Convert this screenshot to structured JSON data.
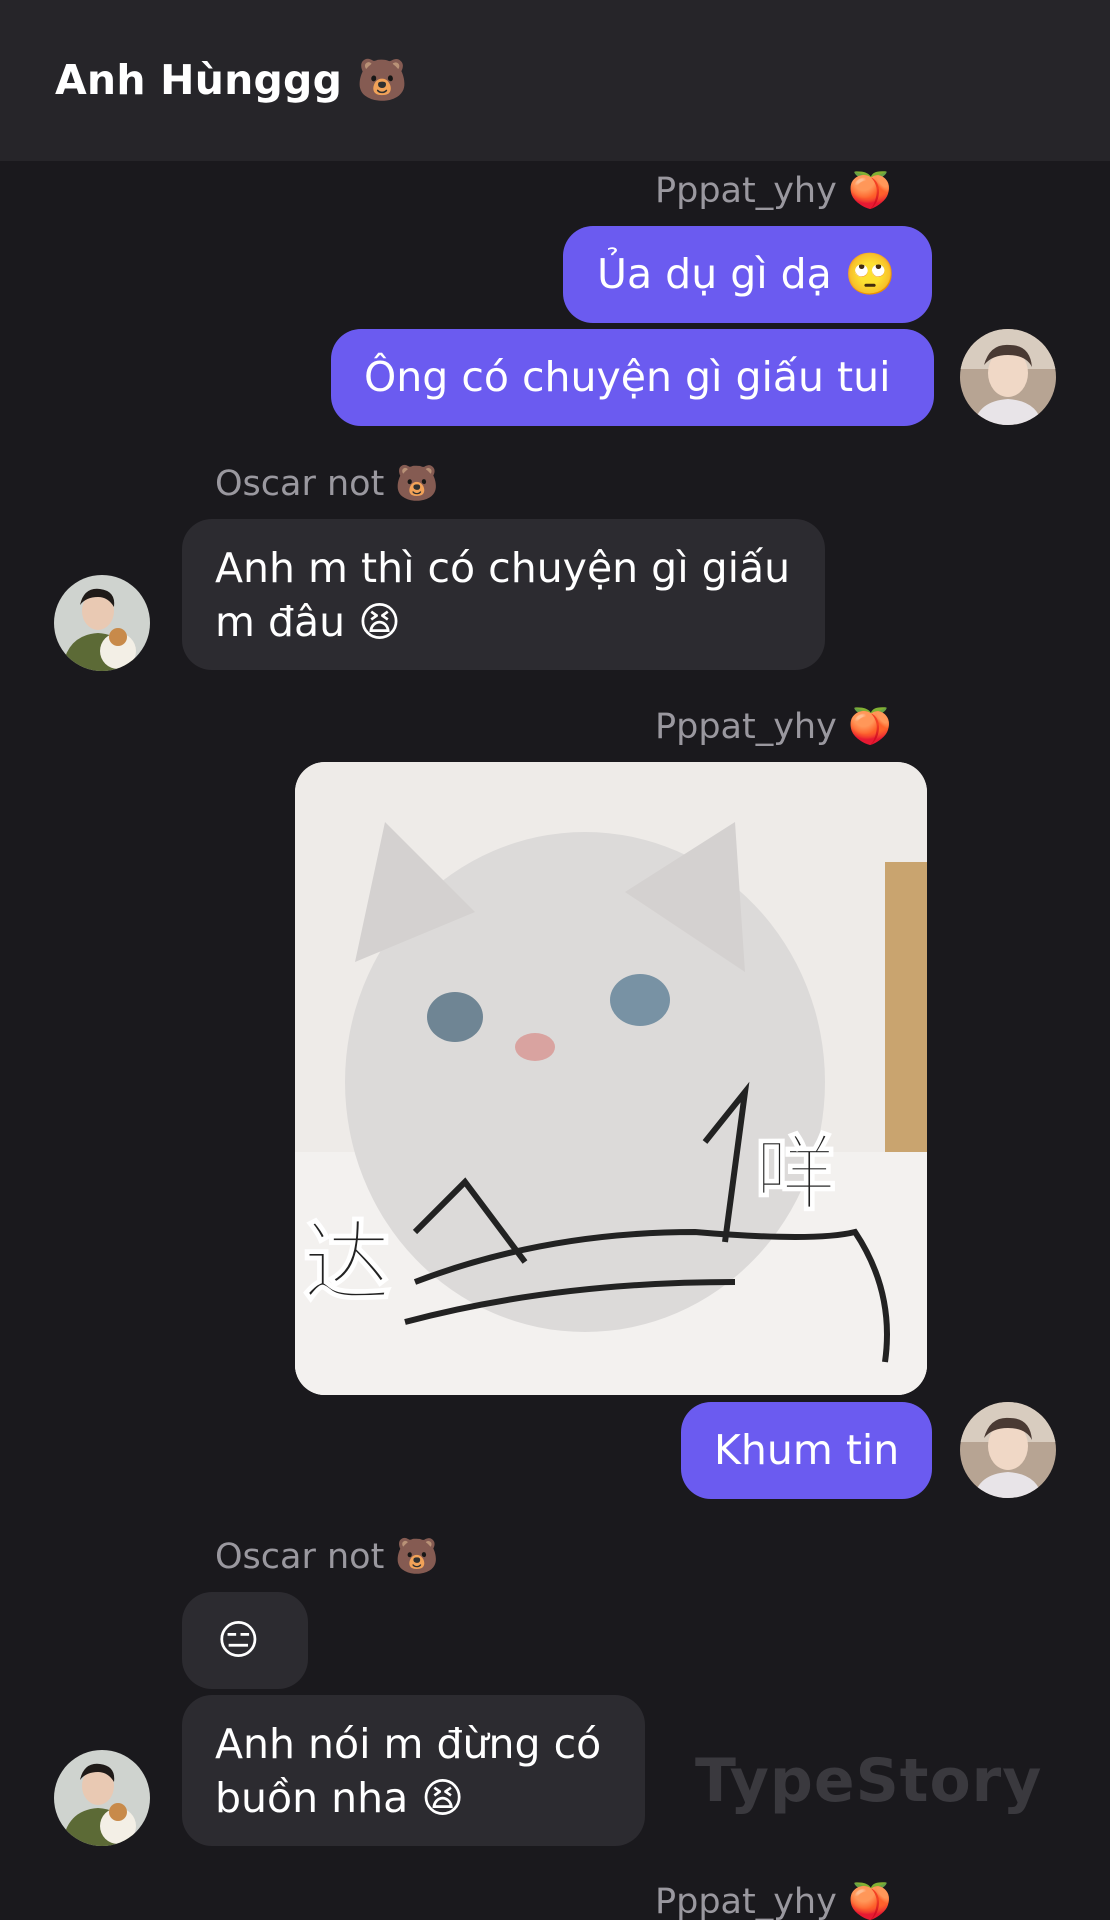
{
  "header": {
    "title": "Anh Hùnggg 🐻"
  },
  "messages": {
    "sender1": "Pppat_yhy 🍑",
    "m1": "Ủa dụ gì dạ 🙄",
    "m2": "Ông có chuyện gì giấu tui",
    "sender2": "Oscar not 🐻",
    "m3_line1": "Anh m thì có chuyện gì giấu",
    "m3_line2": "m đâu 😫",
    "sender3": "Pppat_yhy 🍑",
    "sticker_text_left": "达",
    "sticker_text_right": "咩",
    "m4": "Khum tin",
    "sender4": "Oscar not 🐻",
    "m5": "😑",
    "m6_line1": "Anh nói m đừng có",
    "m6_line2": "buồn nha 😫",
    "sender5": "Pppat_yhy 🍑"
  },
  "watermark": "TypeStory",
  "colors": {
    "background": "#1a191d",
    "header": "#262529",
    "outgoing_bubble": "#6b5bf0",
    "incoming_bubble": "#2c2b30",
    "sender_text": "#9a989f"
  }
}
